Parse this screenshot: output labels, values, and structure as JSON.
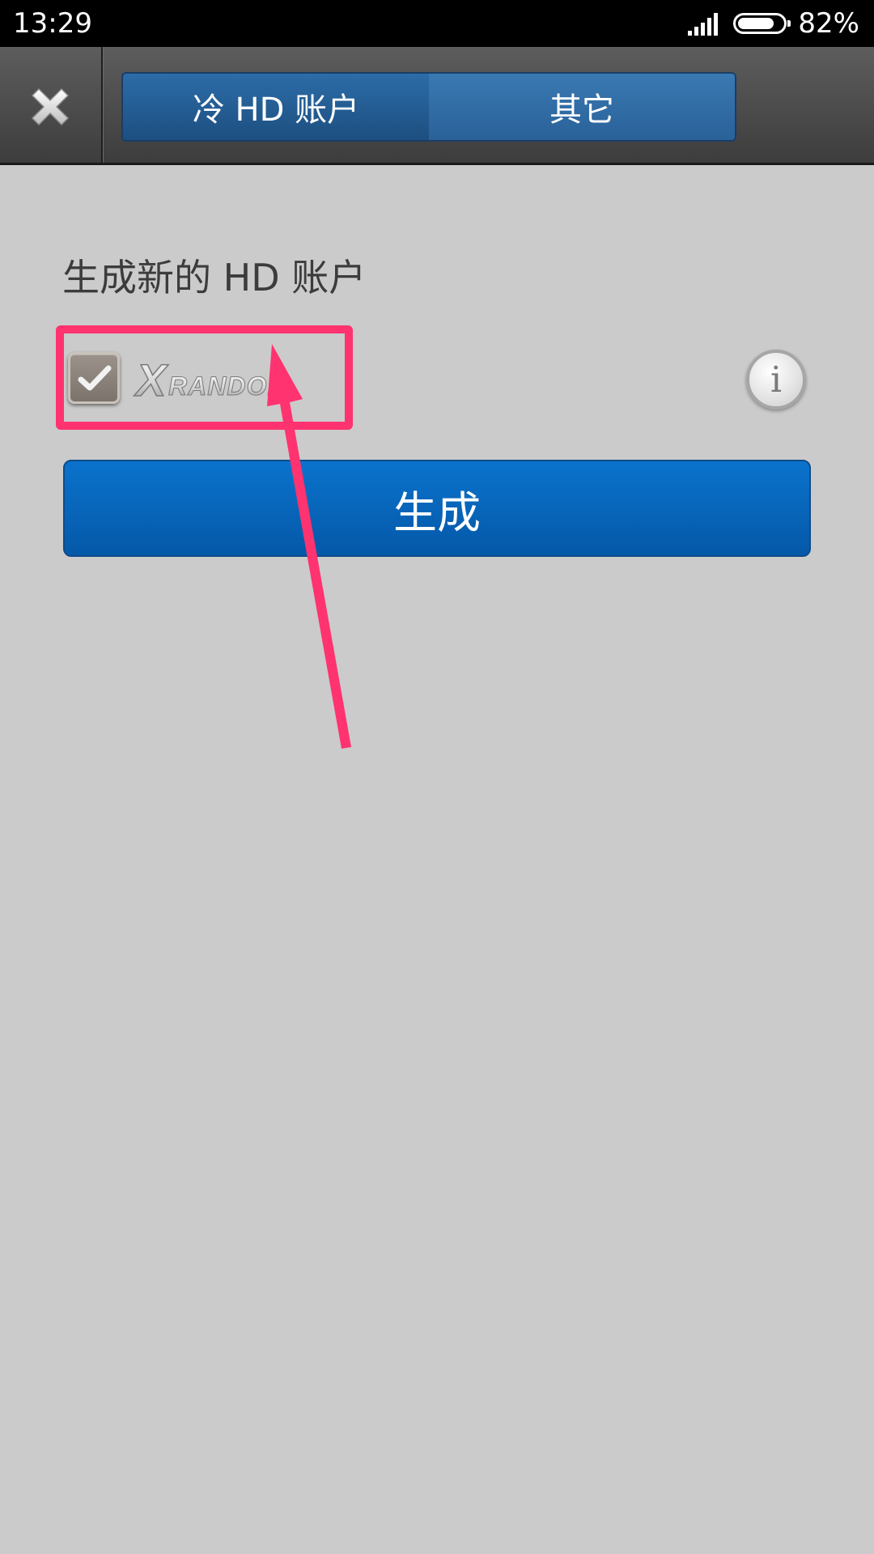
{
  "status_bar": {
    "time": "13:29",
    "battery_percent": "82%",
    "battery_level": 0.82
  },
  "top_bar": {
    "close_icon": "close-x-icon",
    "tabs": [
      {
        "label": "冷 HD 账户",
        "active": true
      },
      {
        "label": "其它",
        "active": false
      }
    ]
  },
  "main": {
    "section_title": "生成新的 HD 账户",
    "xrandom_checkbox": {
      "checked": true,
      "logo_text": "XRANDOM"
    },
    "info_icon": "info-icon",
    "generate_label": "生成"
  },
  "annotation": {
    "color": "#ff3370"
  },
  "colors": {
    "background": "#cbcbcb",
    "button_blue": "#0a6ac0",
    "tab_blue": "#235c90"
  }
}
